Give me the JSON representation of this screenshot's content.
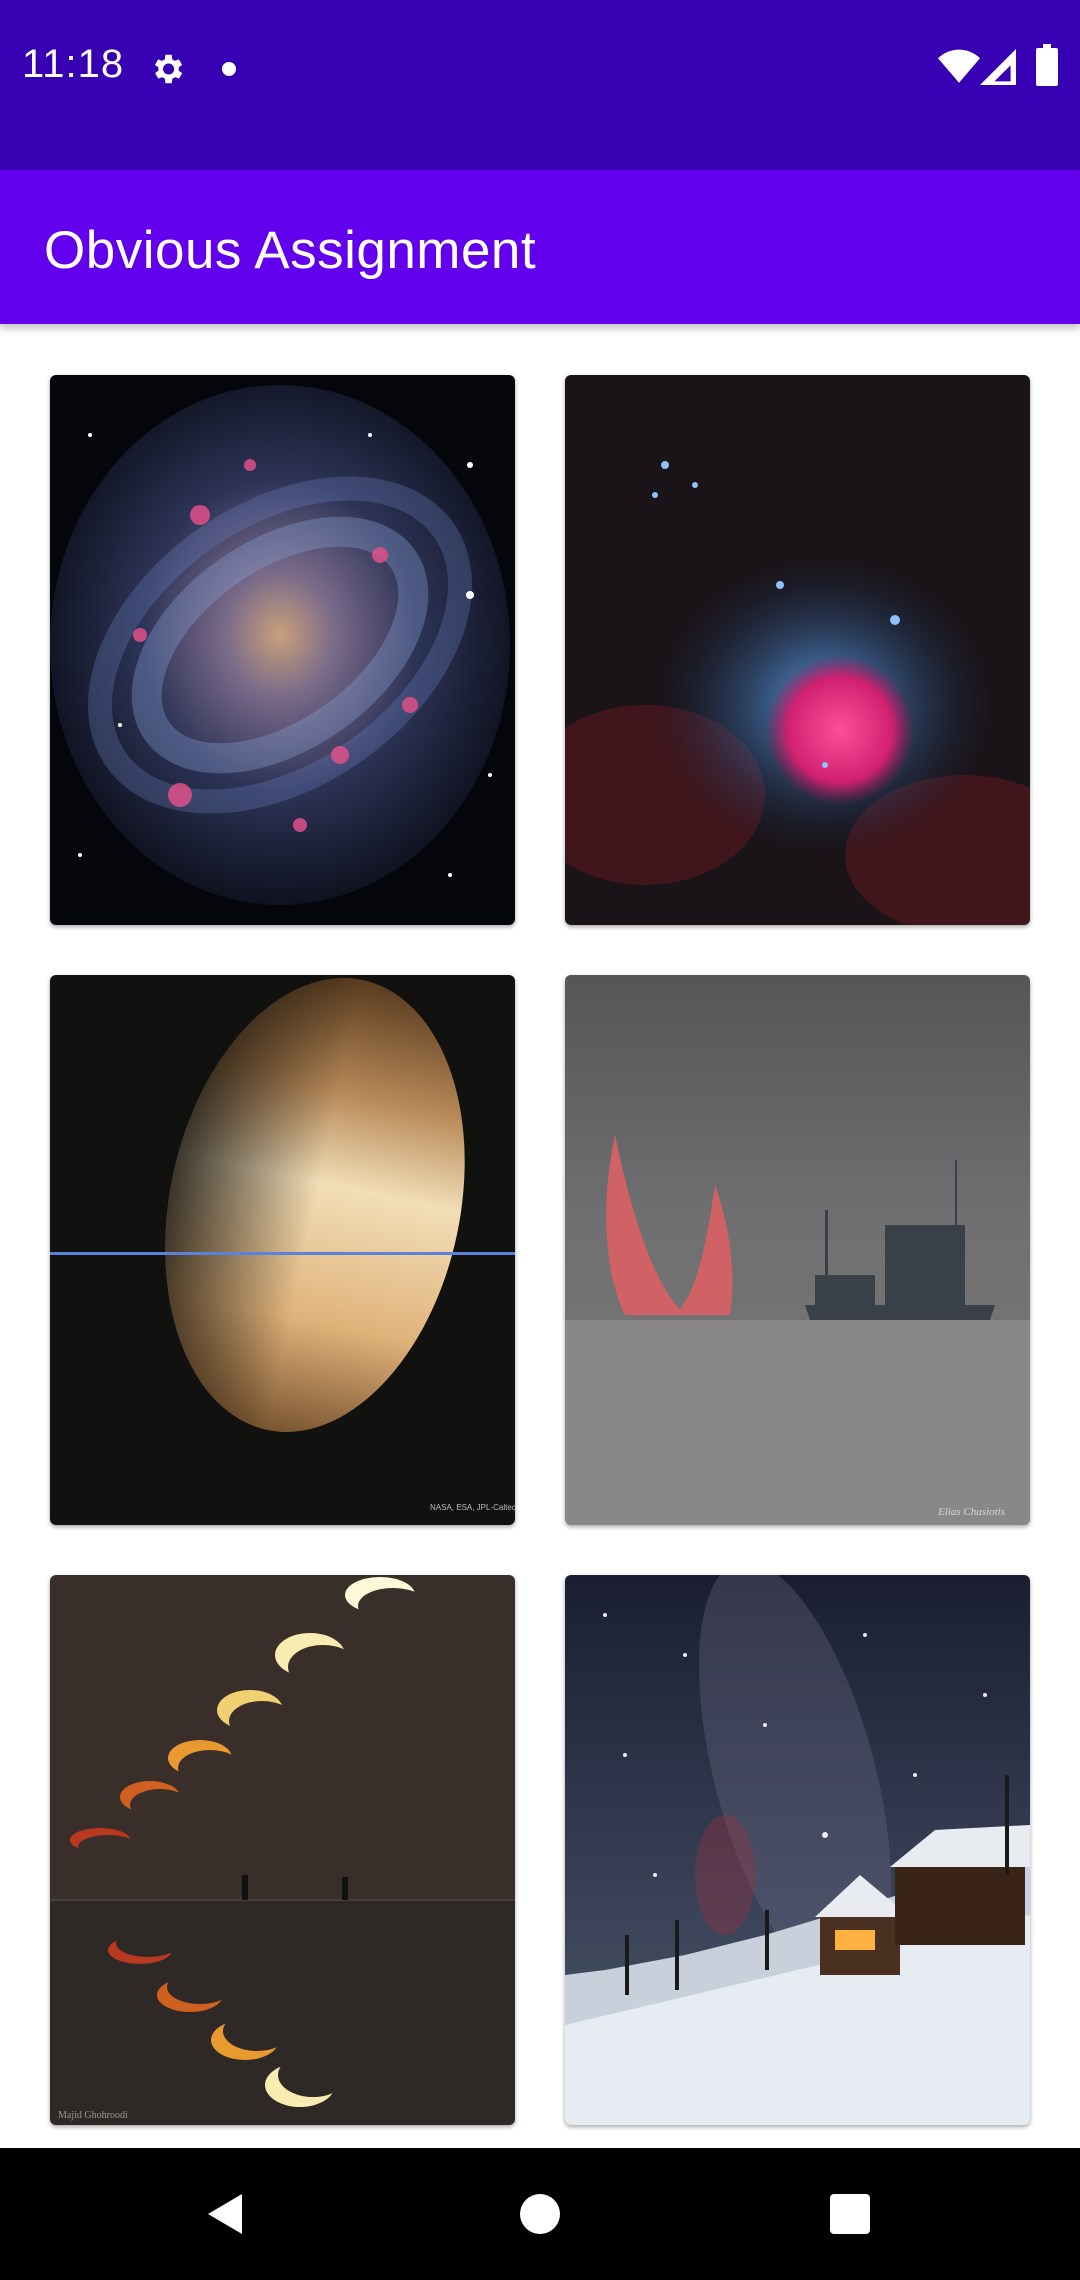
{
  "status_bar": {
    "time": "11:18",
    "icons": [
      "gear-icon",
      "notification-dot-icon",
      "wifi-icon",
      "signal-icon",
      "battery-icon"
    ]
  },
  "app_bar": {
    "title": "Obvious Assignment"
  },
  "colors": {
    "status_bar": "#3700b3",
    "app_bar": "#6200ee",
    "nav_bar": "#000000"
  },
  "gallery": {
    "images": [
      {
        "name": "spiral-galaxy"
      },
      {
        "name": "trifid-nebula"
      },
      {
        "name": "saturn",
        "caption": "NASA, ESA, JPL-Caltech, SSI, Cassini / Processing: Fernando Garcia Navarro"
      },
      {
        "name": "horned-sunrise-ship",
        "caption": "Elias Chasiotis"
      },
      {
        "name": "eclipse-sequence",
        "caption": "Majid Ghohroodi"
      },
      {
        "name": "milky-way-cabin"
      }
    ]
  },
  "nav_bar": {
    "buttons": [
      "back-icon",
      "home-icon",
      "recents-icon"
    ]
  }
}
